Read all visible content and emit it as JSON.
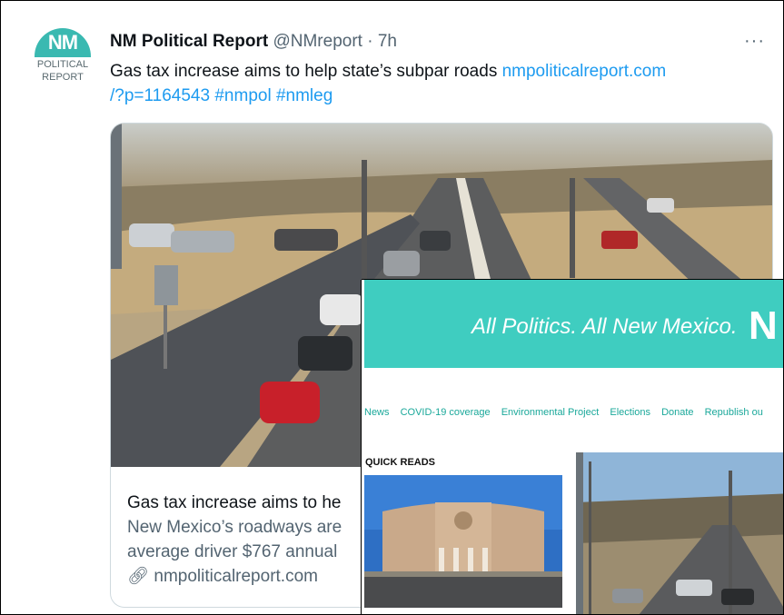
{
  "tweet": {
    "avatar": {
      "logo_text": "NM",
      "line1": "POLITICAL",
      "line2": "REPORT"
    },
    "display_name": "NM Political Report",
    "handle": "@NMreport",
    "separator": " · ",
    "time": "7h",
    "more_label": "···",
    "text": "Gas tax increase aims to help state’s subpar roads ",
    "link_1": "nmpoliticalreport.com",
    "link_2": "/?p=1164543",
    "hashtag_1": "#nmpol",
    "hashtag_2": "#nmleg"
  },
  "card": {
    "title": "Gas tax increase aims to he",
    "desc_line1": "New Mexico’s roadways are",
    "desc_line2": "average driver $767 annual",
    "domain": "nmpoliticalreport.com",
    "link_icon": "link-icon"
  },
  "overlay": {
    "tagline": "All Politics. All New Mexico.",
    "logo_letter": "N",
    "nav": [
      "News",
      "COVID-19 coverage",
      "Environmental Project",
      "Elections",
      "Donate",
      "Republish ou"
    ],
    "section_label": "QUICK READS",
    "accent_color": "#3fcdc0"
  }
}
